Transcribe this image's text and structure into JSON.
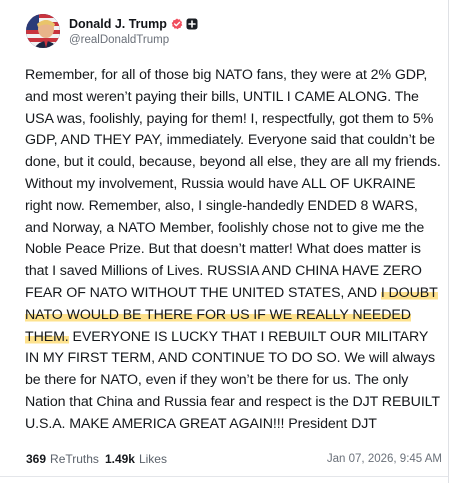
{
  "author": {
    "display_name": "Donald J. Trump",
    "handle": "@realDonaldTrump",
    "verified_icon": "verified-check-icon",
    "plus_icon": "plus-square-icon"
  },
  "post": {
    "text_before_highlight": "Remember, for all of those big NATO fans, they were at 2% GDP, and most weren’t paying their bills, UNTIL I CAME ALONG. The USA was, foolishly, paying for them! I, respectfully, got them to 5% GDP, AND THEY PAY, immediately. Everyone said that couldn’t be done, but it could, because, beyond all else, they are all my friends. Without my involvement, Russia would have ALL OF UKRAINE right now. Remember, also, I single-handedly ENDED 8 WARS, and Norway, a NATO Member, foolishly chose not to give me the Noble Peace Prize. But that doesn’t matter! What does matter is that I saved Millions of Lives. RUSSIA AND CHINA HAVE ZERO FEAR OF NATO WITHOUT THE UNITED STATES, AND ",
    "highlighted_text": "I DOUBT NATO WOULD BE THERE FOR US IF WE REALLY NEEDED THEM.",
    "text_after_highlight": " EVERYONE IS LUCKY THAT I REBUILT OUR MILITARY IN MY FIRST TERM, AND CONTINUE TO DO SO. We will always be there for NATO, even if they won’t be there for us. The only Nation that China and Russia fear and respect is the DJT REBUILT U.S.A. MAKE AMERICA GREAT AGAIN!!! President DJT",
    "highlight_color": "#fdd968"
  },
  "stats": {
    "retruths_count": "369",
    "retruths_label": "ReTruths",
    "likes_count": "1.49k",
    "likes_label": "Likes",
    "timestamp": "Jan 07, 2026, 9:45 AM"
  },
  "colors": {
    "verified_badge": "#f04e5e",
    "plus_badge": "#1b1f24"
  }
}
